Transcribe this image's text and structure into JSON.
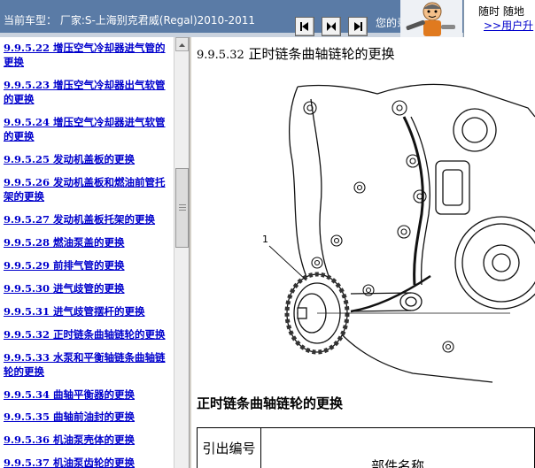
{
  "topbar": {
    "vehicle_label": "当前车型：  厂家:S-上海别克君威(Regal)2010-2011",
    "status_text": "您的录",
    "promo_line1": "随时 随地",
    "promo_link": ">>用户升"
  },
  "toc": {
    "items": [
      "9.9.5.22 增压空气冷却器进气管的更换",
      "9.9.5.23 增压空气冷却器出气软管的更换",
      "9.9.5.24 增压空气冷却器进气软管的更换",
      "9.9.5.25 发动机盖板的更换",
      "9.9.5.26 发动机盖板和燃油前管托架的更换",
      "9.9.5.27 发动机盖板托架的更换",
      "9.9.5.28 燃油泵盖的更换",
      "9.9.5.29 前排气管的更换",
      "9.9.5.30 进气歧管的更换",
      "9.9.5.31 进气歧管摆杆的更换",
      "9.9.5.32 正时链条曲轴链轮的更换",
      "9.9.5.33 水泵和平衡轴链条曲轴链轮的更换",
      "9.9.5.34 曲轴平衡器的更换",
      "9.9.5.35 曲轴前油封的更换",
      "9.9.5.36 机油泵壳体的更换",
      "9.9.5.37 机油泵齿轮的更换"
    ]
  },
  "content": {
    "section_number": "9.9.5.32",
    "title": "正时链条曲轴链轮的更换",
    "figure_callout": "1",
    "subheading": "正时链条曲轴链轮的更换",
    "table_headers": {
      "callout": "引出编号",
      "part_name": "部件名称"
    }
  },
  "icons": [
    "previous-page-icon",
    "home-icon",
    "next-page-icon",
    "mascot-icon",
    "scroll-up-arrow-icon"
  ],
  "colors": {
    "topbar": "#5a7ba6",
    "link": "#0000cc"
  }
}
